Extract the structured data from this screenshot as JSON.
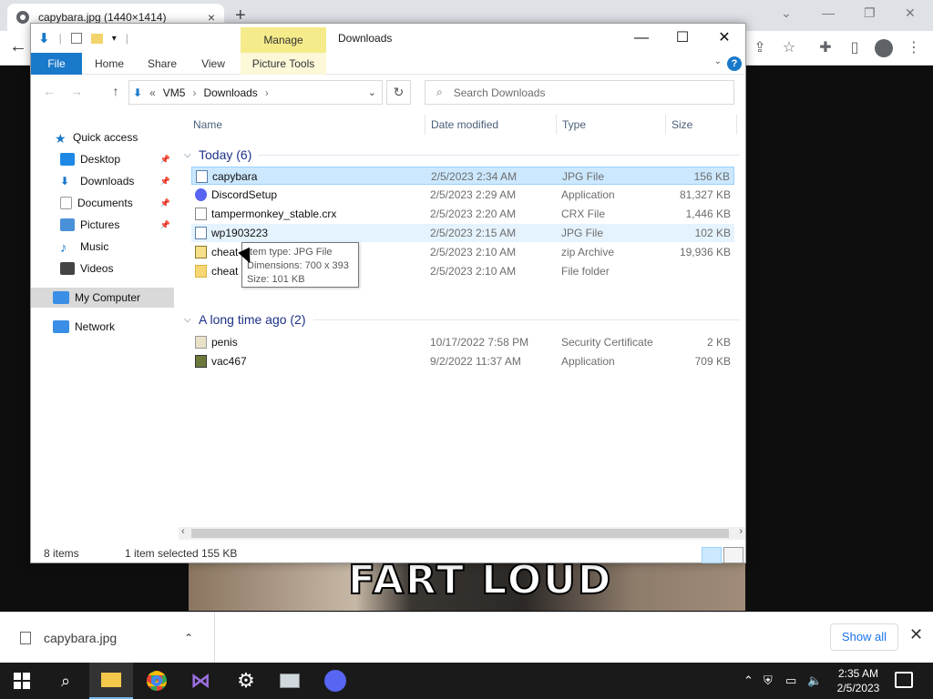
{
  "chrome": {
    "tab_title": "capybara.jpg (1440×1414)",
    "new_tab": "+",
    "tab_close": "×"
  },
  "page": {
    "meme_text": "FART LOUD"
  },
  "explorer": {
    "manage_label": "Manage",
    "window_title": "Downloads",
    "ribbon_tabs": [
      "File",
      "Home",
      "Share",
      "View",
      "Picture Tools"
    ],
    "help": "?",
    "address": {
      "parts": [
        "VM5",
        "Downloads"
      ],
      "overflow": "«"
    },
    "search_placeholder": "Search Downloads",
    "nav_pane": [
      {
        "label": "Quick access",
        "icon": "star-icon",
        "color": "#1979ca"
      },
      {
        "label": "Desktop",
        "icon": "desktop-icon",
        "color": "#1e88e5",
        "pinned": true
      },
      {
        "label": "Downloads",
        "icon": "download-icon",
        "color": "#1979ca",
        "pinned": true
      },
      {
        "label": "Documents",
        "icon": "document-icon",
        "color": "#9e9e9e",
        "pinned": true
      },
      {
        "label": "Pictures",
        "icon": "pictures-icon",
        "color": "#4a90d9",
        "pinned": true
      },
      {
        "label": "Music",
        "icon": "music-icon",
        "color": "#1979ca"
      },
      {
        "label": "Videos",
        "icon": "video-icon",
        "color": "#444"
      },
      {
        "label": "My Computer",
        "icon": "computer-icon",
        "color": "#3a8ee6"
      },
      {
        "label": "Network",
        "icon": "network-icon",
        "color": "#3a8ee6"
      }
    ],
    "columns": [
      "Name",
      "Date modified",
      "Type",
      "Size"
    ],
    "groups": [
      {
        "label": "Today (6)",
        "files": [
          {
            "name": "capybara",
            "date": "2/5/2023 2:34 AM",
            "type": "JPG File",
            "size": "156 KB",
            "state": "selected",
            "icon": "image-file-icon"
          },
          {
            "name": "DiscordSetup",
            "date": "2/5/2023 2:29 AM",
            "type": "Application",
            "size": "81,327 KB",
            "icon": "discord-icon"
          },
          {
            "name": "tampermonkey_stable.crx",
            "date": "2/5/2023 2:20 AM",
            "type": "CRX File",
            "size": "1,446 KB",
            "icon": "file-icon"
          },
          {
            "name": "wp1903223",
            "date": "2/5/2023 2:15 AM",
            "type": "JPG File",
            "size": "102 KB",
            "state": "hover",
            "icon": "image-file-icon"
          },
          {
            "name": "cheat",
            "date": "2/5/2023 2:10 AM",
            "type": "zip Archive",
            "size": "19,936 KB",
            "icon": "zip-icon"
          },
          {
            "name": "cheat",
            "date": "2/5/2023 2:10 AM",
            "type": "File folder",
            "size": "",
            "icon": "folder-icon"
          }
        ]
      },
      {
        "label": "A long time ago (2)",
        "files": [
          {
            "name": "penis",
            "date": "10/17/2022 7:58 PM",
            "type": "Security Certificate",
            "size": "2 KB",
            "icon": "certificate-icon"
          },
          {
            "name": "vac467",
            "date": "9/2/2022 11:37 AM",
            "type": "Application",
            "size": "709 KB",
            "icon": "app-icon"
          }
        ]
      }
    ],
    "tooltip": {
      "item_type": "Item type: JPG File",
      "dimensions": "Dimensions: 700 x 393",
      "size": "Size: 101 KB"
    },
    "status": {
      "count": "8 items",
      "selection": "1 item selected  155 KB"
    }
  },
  "download_bar": {
    "file": "capybara.jpg",
    "show_all": "Show all"
  },
  "taskbar": {
    "time": "2:35 AM",
    "date": "2/5/2023"
  },
  "colors": {
    "accent": "#1979ca",
    "selection": "#cce8ff",
    "manage": "#f5eb8a"
  }
}
